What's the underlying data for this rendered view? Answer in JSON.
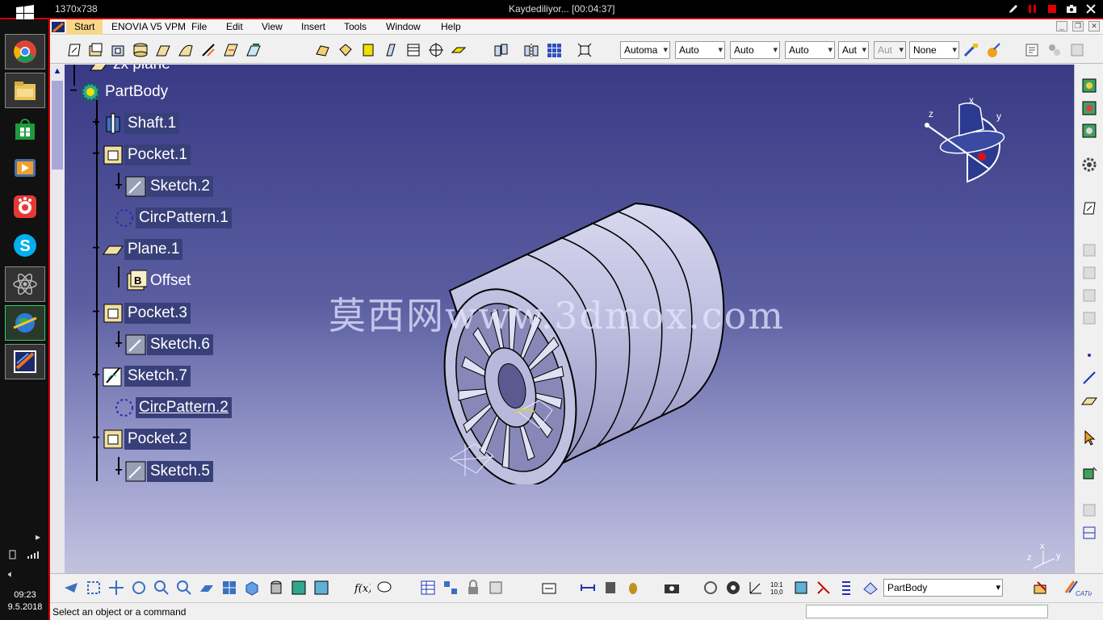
{
  "recorder": {
    "dimensions": "1370x738",
    "title": "Kaydediliyor... [00:04:37]"
  },
  "taskbar": {
    "time": "09:23",
    "date": "9.5.2018",
    "apps": [
      "chrome-icon",
      "file-explorer-icon",
      "store-icon",
      "media-player-icon",
      "camera-app-icon",
      "skype-icon",
      "atom-icon",
      "network-globe-icon",
      "catia-icon"
    ]
  },
  "menu": {
    "start": "Start",
    "enovia": "ENOVIA V5 VPM",
    "items": [
      "File",
      "Edit",
      "View",
      "Insert",
      "Tools",
      "Window",
      "Help"
    ]
  },
  "toolbar": {
    "combos": [
      "Automa",
      "Auto",
      "Auto",
      "Auto",
      "Aut",
      "Aut",
      "None"
    ]
  },
  "tree": {
    "top_partial": "zx plane",
    "nodes": [
      {
        "label": "PartBody"
      },
      {
        "label": "Shaft.1"
      },
      {
        "label": "Pocket.1"
      },
      {
        "label": "Sketch.2"
      },
      {
        "label": "CircPattern.1"
      },
      {
        "label": "Plane.1"
      },
      {
        "label": "Offset"
      },
      {
        "label": "Pocket.3"
      },
      {
        "label": "Sketch.6"
      },
      {
        "label": "Sketch.7"
      },
      {
        "label": "CircPattern.2"
      },
      {
        "label": "Pocket.2"
      },
      {
        "label": "Sketch.5"
      }
    ]
  },
  "viewport": {
    "watermark": "莫西网www.3dmox.com",
    "compass_labels": {
      "x": "x",
      "y": "y",
      "z": "z"
    },
    "axis_labels": {
      "x": "x",
      "y": "y",
      "z": "z"
    }
  },
  "bottom": {
    "part_selector": "PartBody",
    "catia_logo": "CATIA"
  },
  "status": {
    "message": "Select an object or a command"
  }
}
